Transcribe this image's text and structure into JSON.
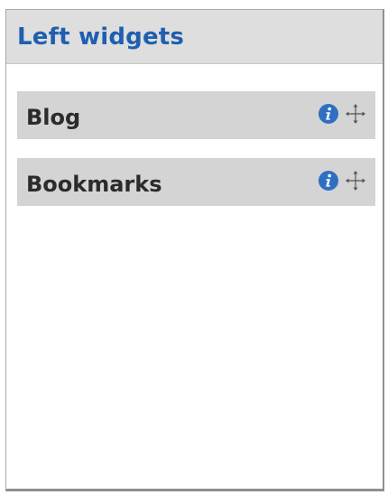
{
  "panel": {
    "title": "Left widgets"
  },
  "widgets": [
    {
      "label": "Blog",
      "info_icon": "info-icon",
      "move_icon": "move-icon"
    },
    {
      "label": "Bookmarks",
      "info_icon": "info-icon",
      "move_icon": "move-icon"
    }
  ],
  "colors": {
    "title": "#1f5fb0",
    "header_bg": "#dedede",
    "widget_bg": "#d4d4d4",
    "info_icon": "#2f6fc2"
  }
}
